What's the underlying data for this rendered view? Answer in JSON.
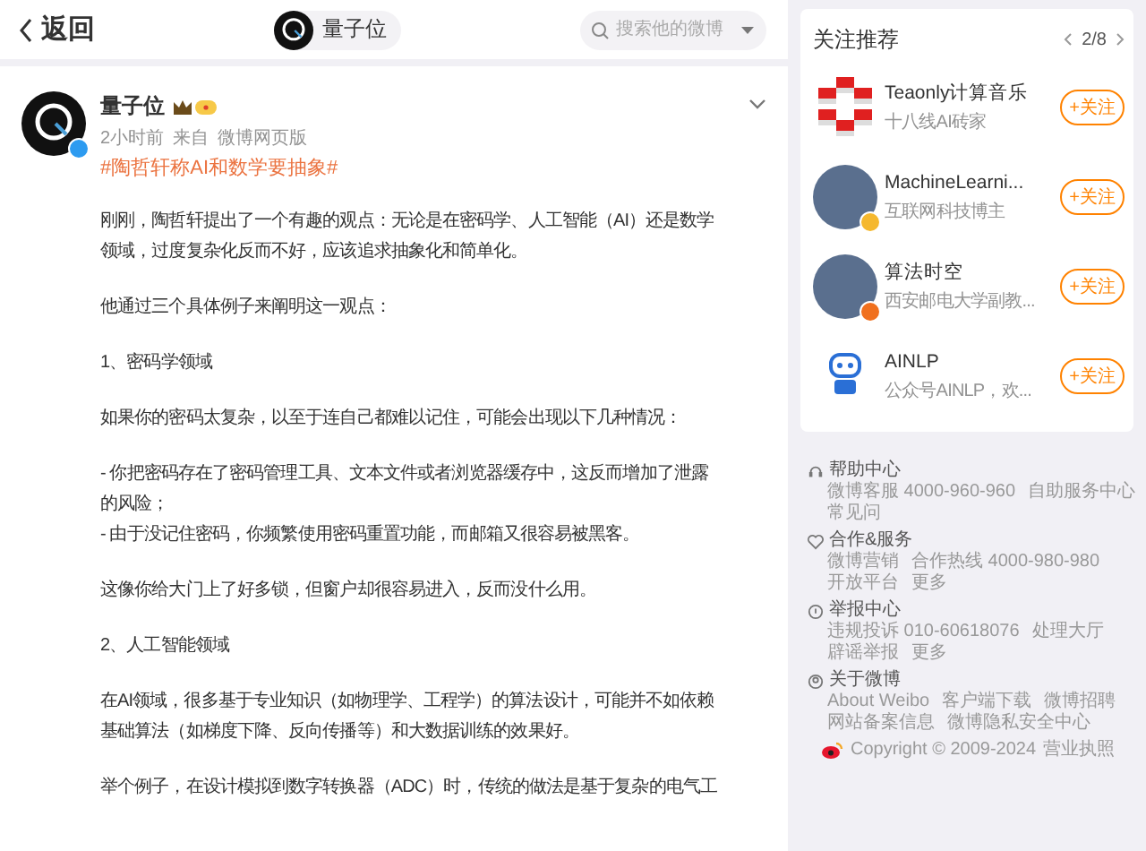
{
  "top_bar": {
    "back_label": "返回",
    "account_name": "量子位",
    "search": {
      "placeholder": "搜索他的微博"
    }
  },
  "post": {
    "author": "量子位",
    "verified": true,
    "time": "2小时前",
    "source_prefix": "来自",
    "source": "微博网页版",
    "hashtag": "#陶哲轩称AI和数学要抽象#",
    "paragraphs": [
      {
        "lines": [
          "刚刚，陶哲轩提出了一个有趣的观点：无论是在密码学、人工智能（AI）还是数学领域，过度复杂化反而不好，应该追求抽象化和简单化。"
        ]
      },
      {
        "lines": [
          "他通过三个具体例子来阐明这一观点："
        ]
      },
      {
        "lines": [
          "1、密码学领域"
        ]
      },
      {
        "lines": [
          "如果你的密码太复杂，以至于连自己都难以记住，可能会出现以下几种情况："
        ]
      },
      {
        "lines": [
          "- 你把密码存在了密码管理工具、文本文件或者浏览器缓存中，这反而增加了泄露的风险；",
          "- 由于没记住密码，你频繁使用密码重置功能，而邮箱又很容易被黑客。"
        ]
      },
      {
        "lines": [
          "这像你给大门上了好多锁，但窗户却很容易进入，反而没什么用。"
        ]
      },
      {
        "lines": [
          "2、人工智能领域"
        ]
      },
      {
        "lines": [
          "在AI领域，很多基于专业知识（如物理学、工程学）的算法设计，可能并不如依赖基础算法（如梯度下降、反向传播等）和大数据训练的效果好。"
        ]
      },
      {
        "lines": [
          "举个例子，在设计模拟到数字转换器（ADC）时，传统的做法是基于复杂的电气工"
        ]
      }
    ]
  },
  "recommend": {
    "title": "关注推荐",
    "page": "2/8",
    "users": [
      {
        "kind": "cubes",
        "name": "Teaonly计算音乐",
        "desc": "十八线AI砖家",
        "button": "+关注"
      },
      {
        "kind": "photo",
        "name": "MachineLearni...",
        "desc": "互联网科技博主",
        "button": "+关注",
        "badge": {
          "color": "#f5b82e"
        }
      },
      {
        "kind": "photo",
        "name": "算法时空",
        "desc": "西安邮电大学副教...",
        "button": "+关注",
        "badge": {
          "color": "#f0701e"
        }
      },
      {
        "kind": "robot",
        "name": "AINLP",
        "desc": "公众号AINLP，欢...",
        "button": "+关注"
      }
    ]
  },
  "footer": {
    "sections": [
      {
        "kind": "help",
        "title": "帮助中心",
        "links": [
          "微博客服 4000-960-960",
          "自助服务中心",
          "常见问"
        ]
      },
      {
        "kind": "heart",
        "title": "合作&服务",
        "links": [
          "微博营销",
          "合作热线 4000-980-980",
          "开放平台",
          "更多"
        ]
      },
      {
        "kind": "info",
        "title": "举报中心",
        "links": [
          "违规投诉 010-60618076",
          "处理大厅",
          "辟谣举报",
          "更多"
        ]
      },
      {
        "kind": "about",
        "title": "关于微博",
        "links": [
          "About Weibo",
          "客户端下载",
          "微博招聘",
          "网站备案信息",
          "微博隐私安全中心"
        ]
      }
    ],
    "copyright": "Copyright © 2009-2024",
    "license": "营业执照"
  }
}
